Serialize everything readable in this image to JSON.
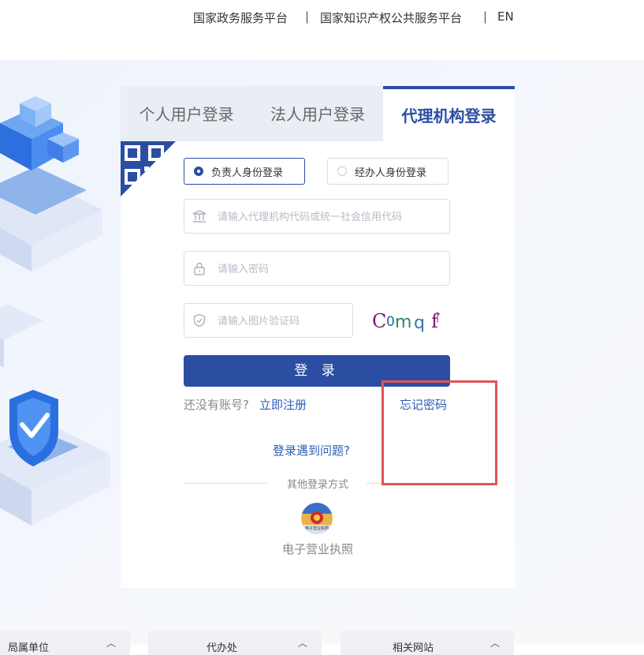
{
  "topnav": {
    "link1": "国家政务服务平台",
    "sep": "|",
    "link2": "国家知识产权公共服务平台",
    "lang": "EN"
  },
  "login": {
    "tabs": [
      "个人用户登录",
      "法人用户登录",
      "代理机构登录"
    ],
    "active_tab": 2,
    "radio_principal": "负责人身份登录",
    "radio_agent": "经办人身份登录",
    "org_code_placeholder": "请输入代理机构代码或统一社会信用代码",
    "password_placeholder": "请输入密码",
    "captcha_placeholder": "请输入图片验证码",
    "captcha_text": "Comq f",
    "login_button": "登 录",
    "no_account": "还没有账号?",
    "register": "立即注册",
    "forgot": "忘记密码",
    "trouble": "登录遇到问题?",
    "other_methods": "其他登录方式",
    "ebl_label": "电子营业执照",
    "ebl_badge": "电子营业执照"
  },
  "footer": {
    "sel1": "局属单位",
    "sel2": "代办处",
    "sel3": "相关网站"
  },
  "colors": {
    "primary": "#2b4ea2",
    "link": "#2b5fb5",
    "highlight": "#e05555"
  }
}
